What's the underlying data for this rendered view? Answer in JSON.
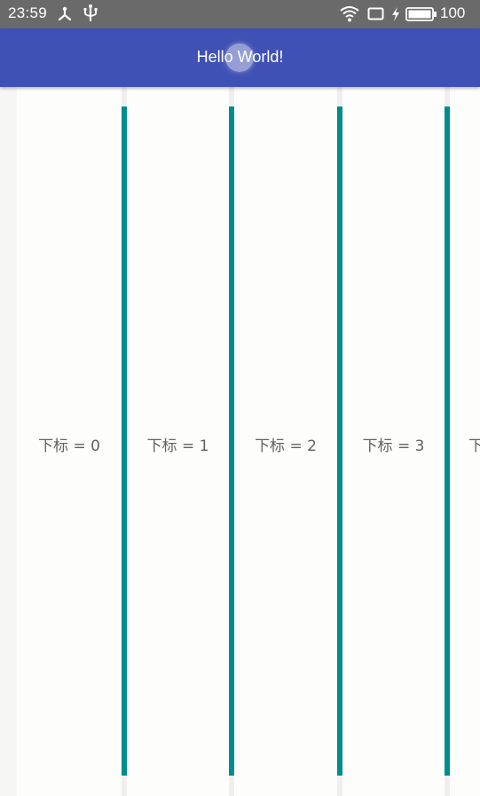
{
  "status_bar": {
    "time": "23:59",
    "battery": "100"
  },
  "app_bar": {
    "title": "Hello World!"
  },
  "list": {
    "items": [
      {
        "label": "下标 = 0"
      },
      {
        "label": "下标 = 1"
      },
      {
        "label": "下标 = 2"
      },
      {
        "label": "下标 = 3"
      },
      {
        "label": "下"
      }
    ]
  },
  "colors": {
    "app_bar": "#3f51b5",
    "divider": "#008c8c",
    "status_bar": "#6a6a6a"
  }
}
